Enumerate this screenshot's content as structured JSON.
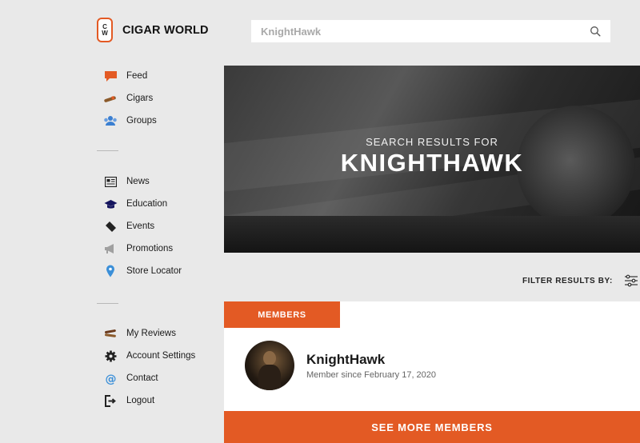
{
  "brand": {
    "badge_top": "C",
    "badge_bottom": "W",
    "name": "CIGAR WORLD",
    "accent": "#e35a24"
  },
  "search": {
    "value": "KnightHawk",
    "icon": "search-icon"
  },
  "sidebar": {
    "primary": [
      {
        "label": "Feed",
        "icon": "chat-bubble-icon"
      },
      {
        "label": "Cigars",
        "icon": "cigar-icon"
      },
      {
        "label": "Groups",
        "icon": "group-icon"
      }
    ],
    "secondary": [
      {
        "label": "News",
        "icon": "newspaper-icon"
      },
      {
        "label": "Education",
        "icon": "graduation-cap-icon"
      },
      {
        "label": "Events",
        "icon": "ticket-icon"
      },
      {
        "label": "Promotions",
        "icon": "megaphone-icon"
      },
      {
        "label": "Store Locator",
        "icon": "map-pin-icon"
      }
    ],
    "account": [
      {
        "label": "My Reviews",
        "icon": "reviews-icon"
      },
      {
        "label": "Account Settings",
        "icon": "gear-icon"
      },
      {
        "label": "Contact",
        "icon": "at-sign-icon"
      },
      {
        "label": "Logout",
        "icon": "logout-icon"
      }
    ]
  },
  "hero": {
    "subtitle": "SEARCH RESULTS FOR",
    "title": "KNIGHTHAWK"
  },
  "filter": {
    "label": "FILTER RESULTS BY:",
    "icon": "sliders-icon"
  },
  "results": {
    "tab_label": "MEMBERS",
    "member": {
      "name": "KnightHawk",
      "since": "Member since February 17, 2020"
    },
    "more_label": "SEE MORE MEMBERS"
  }
}
